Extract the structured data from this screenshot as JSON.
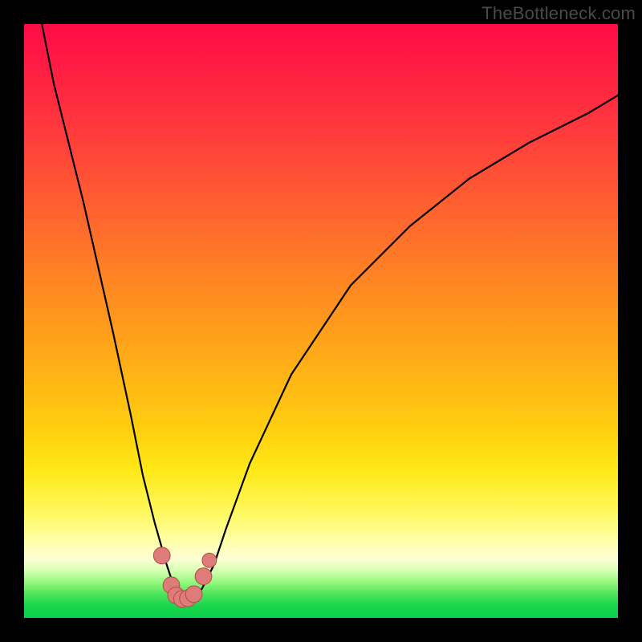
{
  "watermark": "TheBottleneck.com",
  "colors": {
    "frame": "#000000",
    "curve": "#000000",
    "marker_fill": "#de7c7a",
    "marker_stroke": "#b44b47"
  },
  "chart_data": {
    "type": "line",
    "title": "",
    "xlabel": "",
    "ylabel": "",
    "xlim": [
      0,
      100
    ],
    "ylim": [
      0,
      100
    ],
    "grid": false,
    "series": [
      {
        "name": "curve",
        "x": [
          3,
          5,
          10,
          15,
          18,
          20,
          22,
          24,
          25,
          26,
          27,
          28,
          29,
          30,
          32,
          34,
          38,
          45,
          55,
          65,
          75,
          85,
          95,
          100
        ],
        "y": [
          100,
          90,
          70,
          48,
          34,
          24,
          16,
          9,
          6,
          4,
          3,
          3,
          3.5,
          5,
          9,
          15,
          26,
          41,
          56,
          66,
          74,
          80,
          85,
          88
        ]
      }
    ],
    "markers": [
      {
        "x": 23.2,
        "y": 10.5,
        "r": 1.4
      },
      {
        "x": 24.8,
        "y": 5.5,
        "r": 1.4
      },
      {
        "x": 25.6,
        "y": 3.8,
        "r": 1.4
      },
      {
        "x": 26.6,
        "y": 3.2,
        "r": 1.4
      },
      {
        "x": 27.6,
        "y": 3.3,
        "r": 1.4
      },
      {
        "x": 28.6,
        "y": 4.0,
        "r": 1.4
      },
      {
        "x": 30.2,
        "y": 7.0,
        "r": 1.4
      },
      {
        "x": 31.2,
        "y": 9.7,
        "r": 1.2
      }
    ]
  }
}
